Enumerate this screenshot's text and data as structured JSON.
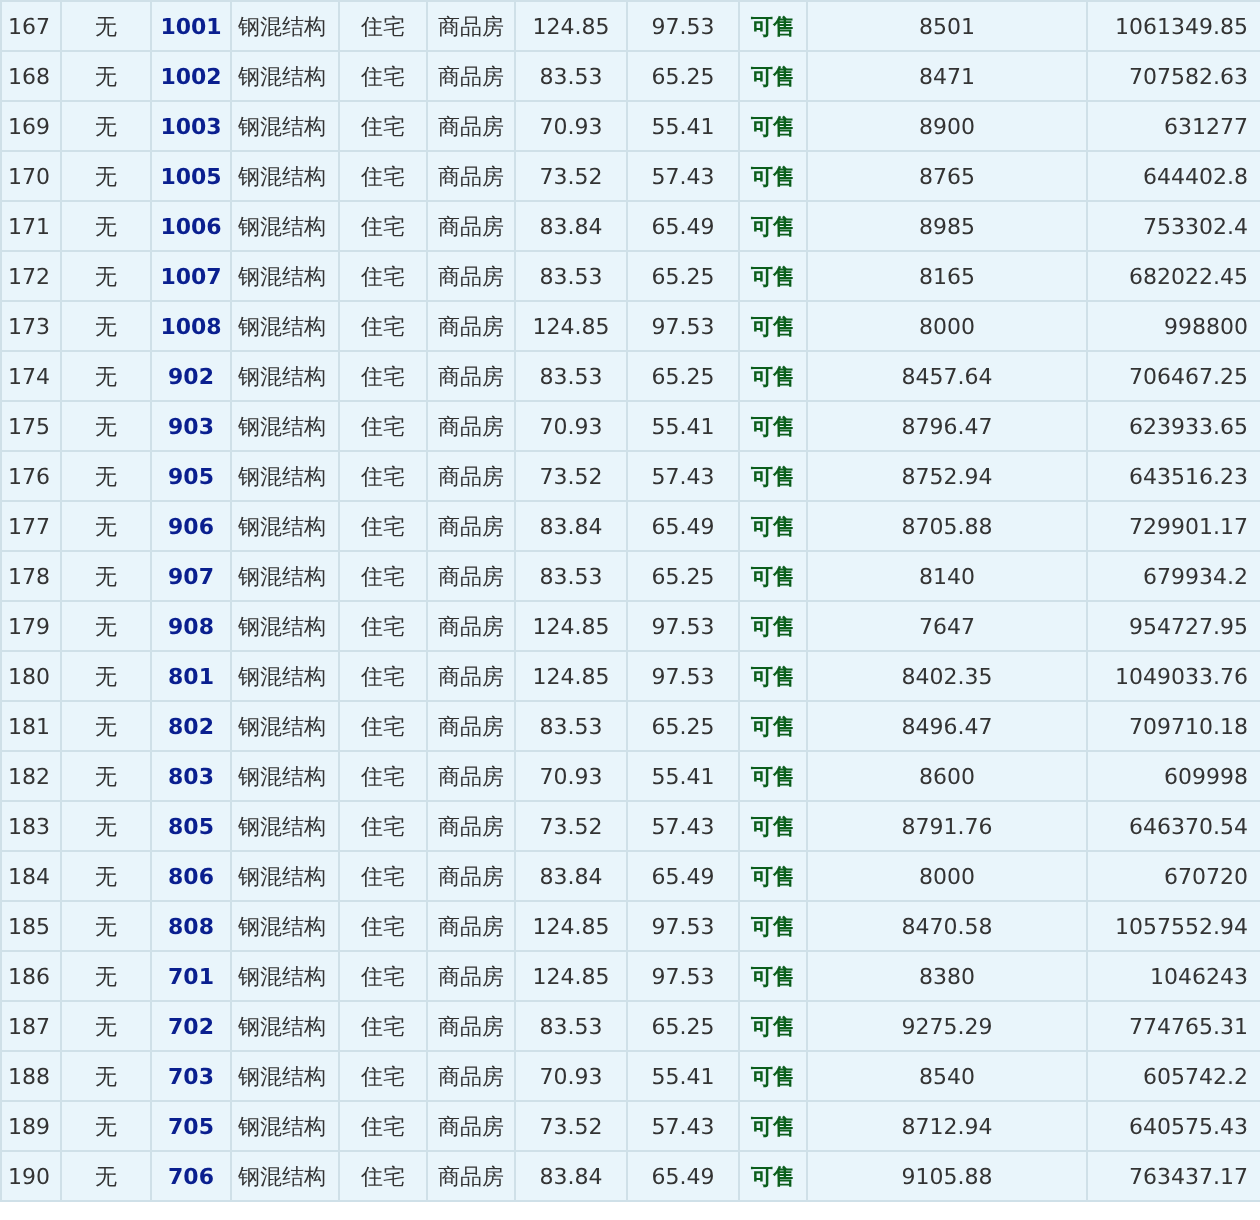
{
  "table": {
    "rows": [
      {
        "cells": [
          "167",
          "无",
          "1001",
          "钢混结构",
          "住宅",
          "商品房",
          "124.85",
          "97.53",
          "可售",
          "8501",
          "1061349.85"
        ]
      },
      {
        "cells": [
          "168",
          "无",
          "1002",
          "钢混结构",
          "住宅",
          "商品房",
          "83.53",
          "65.25",
          "可售",
          "8471",
          "707582.63"
        ]
      },
      {
        "cells": [
          "169",
          "无",
          "1003",
          "钢混结构",
          "住宅",
          "商品房",
          "70.93",
          "55.41",
          "可售",
          "8900",
          "631277"
        ]
      },
      {
        "cells": [
          "170",
          "无",
          "1005",
          "钢混结构",
          "住宅",
          "商品房",
          "73.52",
          "57.43",
          "可售",
          "8765",
          "644402.8"
        ]
      },
      {
        "cells": [
          "171",
          "无",
          "1006",
          "钢混结构",
          "住宅",
          "商品房",
          "83.84",
          "65.49",
          "可售",
          "8985",
          "753302.4"
        ]
      },
      {
        "cells": [
          "172",
          "无",
          "1007",
          "钢混结构",
          "住宅",
          "商品房",
          "83.53",
          "65.25",
          "可售",
          "8165",
          "682022.45"
        ]
      },
      {
        "cells": [
          "173",
          "无",
          "1008",
          "钢混结构",
          "住宅",
          "商品房",
          "124.85",
          "97.53",
          "可售",
          "8000",
          "998800"
        ]
      },
      {
        "cells": [
          "174",
          "无",
          "902",
          "钢混结构",
          "住宅",
          "商品房",
          "83.53",
          "65.25",
          "可售",
          "8457.64",
          "706467.25"
        ]
      },
      {
        "cells": [
          "175",
          "无",
          "903",
          "钢混结构",
          "住宅",
          "商品房",
          "70.93",
          "55.41",
          "可售",
          "8796.47",
          "623933.65"
        ]
      },
      {
        "cells": [
          "176",
          "无",
          "905",
          "钢混结构",
          "住宅",
          "商品房",
          "73.52",
          "57.43",
          "可售",
          "8752.94",
          "643516.23"
        ]
      },
      {
        "cells": [
          "177",
          "无",
          "906",
          "钢混结构",
          "住宅",
          "商品房",
          "83.84",
          "65.49",
          "可售",
          "8705.88",
          "729901.17"
        ]
      },
      {
        "cells": [
          "178",
          "无",
          "907",
          "钢混结构",
          "住宅",
          "商品房",
          "83.53",
          "65.25",
          "可售",
          "8140",
          "679934.2"
        ]
      },
      {
        "cells": [
          "179",
          "无",
          "908",
          "钢混结构",
          "住宅",
          "商品房",
          "124.85",
          "97.53",
          "可售",
          "7647",
          "954727.95"
        ]
      },
      {
        "cells": [
          "180",
          "无",
          "801",
          "钢混结构",
          "住宅",
          "商品房",
          "124.85",
          "97.53",
          "可售",
          "8402.35",
          "1049033.76"
        ]
      },
      {
        "cells": [
          "181",
          "无",
          "802",
          "钢混结构",
          "住宅",
          "商品房",
          "83.53",
          "65.25",
          "可售",
          "8496.47",
          "709710.18"
        ]
      },
      {
        "cells": [
          "182",
          "无",
          "803",
          "钢混结构",
          "住宅",
          "商品房",
          "70.93",
          "55.41",
          "可售",
          "8600",
          "609998"
        ]
      },
      {
        "cells": [
          "183",
          "无",
          "805",
          "钢混结构",
          "住宅",
          "商品房",
          "73.52",
          "57.43",
          "可售",
          "8791.76",
          "646370.54"
        ]
      },
      {
        "cells": [
          "184",
          "无",
          "806",
          "钢混结构",
          "住宅",
          "商品房",
          "83.84",
          "65.49",
          "可售",
          "8000",
          "670720"
        ]
      },
      {
        "cells": [
          "185",
          "无",
          "808",
          "钢混结构",
          "住宅",
          "商品房",
          "124.85",
          "97.53",
          "可售",
          "8470.58",
          "1057552.94"
        ]
      },
      {
        "cells": [
          "186",
          "无",
          "701",
          "钢混结构",
          "住宅",
          "商品房",
          "124.85",
          "97.53",
          "可售",
          "8380",
          "1046243"
        ]
      },
      {
        "cells": [
          "187",
          "无",
          "702",
          "钢混结构",
          "住宅",
          "商品房",
          "83.53",
          "65.25",
          "可售",
          "9275.29",
          "774765.31"
        ]
      },
      {
        "cells": [
          "188",
          "无",
          "703",
          "钢混结构",
          "住宅",
          "商品房",
          "70.93",
          "55.41",
          "可售",
          "8540",
          "605742.2"
        ]
      },
      {
        "cells": [
          "189",
          "无",
          "705",
          "钢混结构",
          "住宅",
          "商品房",
          "73.52",
          "57.43",
          "可售",
          "8712.94",
          "640575.43"
        ]
      },
      {
        "cells": [
          "190",
          "无",
          "706",
          "钢混结构",
          "住宅",
          "商品房",
          "83.84",
          "65.49",
          "可售",
          "9105.88",
          "763437.17"
        ]
      }
    ]
  }
}
